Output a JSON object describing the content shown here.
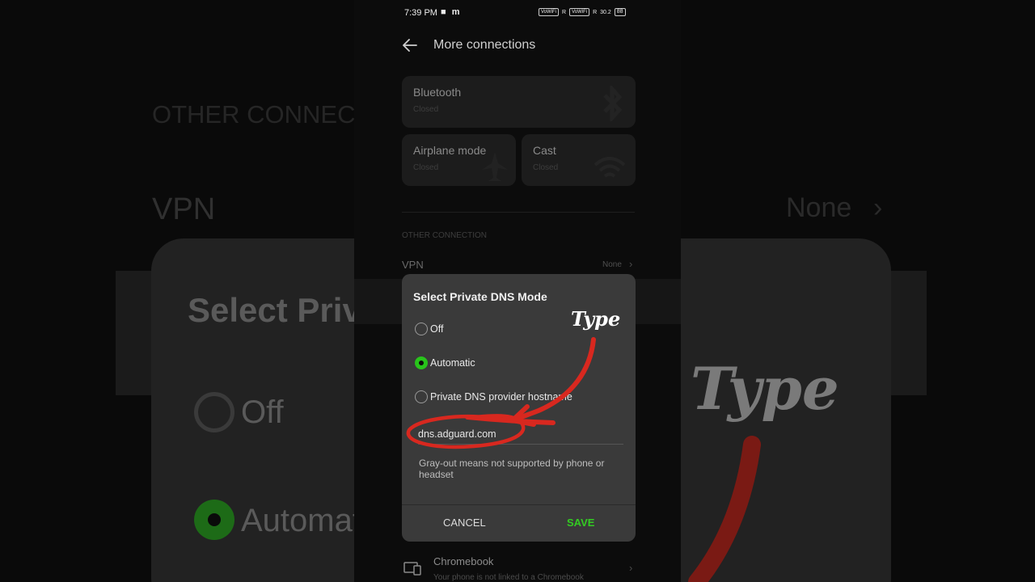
{
  "status_bar": {
    "time": "7:39 PM",
    "left_icons": [
      "video-icon",
      "m-icon"
    ],
    "sim1_tag": "VoWiFi",
    "sim2_tag": "VoWiFi",
    "signal1": "R",
    "signal2": "R",
    "speed": "30.2",
    "battery": "88"
  },
  "header": {
    "title": "More connections"
  },
  "tiles": {
    "bluetooth": {
      "title": "Bluetooth",
      "status": "Closed"
    },
    "airplane": {
      "title": "Airplane mode",
      "status": "Closed"
    },
    "cast": {
      "title": "Cast",
      "status": "Closed"
    }
  },
  "other": {
    "section_label": "OTHER CONNECTION",
    "vpn_label": "VPN",
    "vpn_value": "None"
  },
  "dialog": {
    "title": "Select Private DNS Mode",
    "options": [
      {
        "label": "Off",
        "selected": false
      },
      {
        "label": "Automatic",
        "selected": true
      },
      {
        "label": "Private DNS provider hostname",
        "selected": false
      }
    ],
    "hostname_value": "dns.adguard.com",
    "hint": "Gray-out means not supported by phone or headset",
    "cancel_label": "CANCEL",
    "save_label": "SAVE"
  },
  "annotation": {
    "text": "Type"
  },
  "chromebook": {
    "title": "Chromebook",
    "subtitle": "Your phone is not linked to a Chromebook"
  },
  "background": {
    "left_section": "OTHER CONNECT",
    "left_vpn": "VPN",
    "left_dialog_title": "Select Priva",
    "left_off": "Off",
    "left_auto": "Automat",
    "right_vpn_value": "None",
    "right_anno": "Type"
  },
  "colors": {
    "accent_green": "#33cc22",
    "radio_green": "#28c41b",
    "annotation_red": "#d8281f",
    "dialog_bg": "#3a3a3a"
  }
}
